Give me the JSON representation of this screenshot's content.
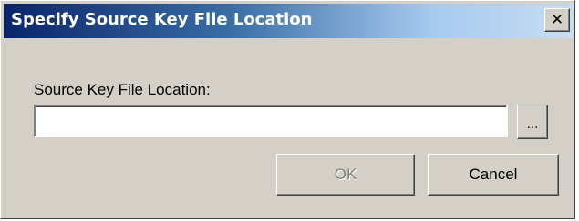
{
  "window": {
    "title": "Specify Source Key File Location",
    "close_glyph": "✕"
  },
  "form": {
    "label": "Source Key File Location:",
    "path_value": "",
    "path_placeholder": "",
    "browse_label": "..."
  },
  "buttons": {
    "ok_label": "OK",
    "ok_enabled": false,
    "cancel_label": "Cancel"
  },
  "icons": {
    "close": "close-icon"
  },
  "colors": {
    "title_gradient_start": "#0a246a",
    "title_gradient_end": "#c8dcf0",
    "face": "#d4d0c8",
    "disabled_text": "#808080"
  }
}
